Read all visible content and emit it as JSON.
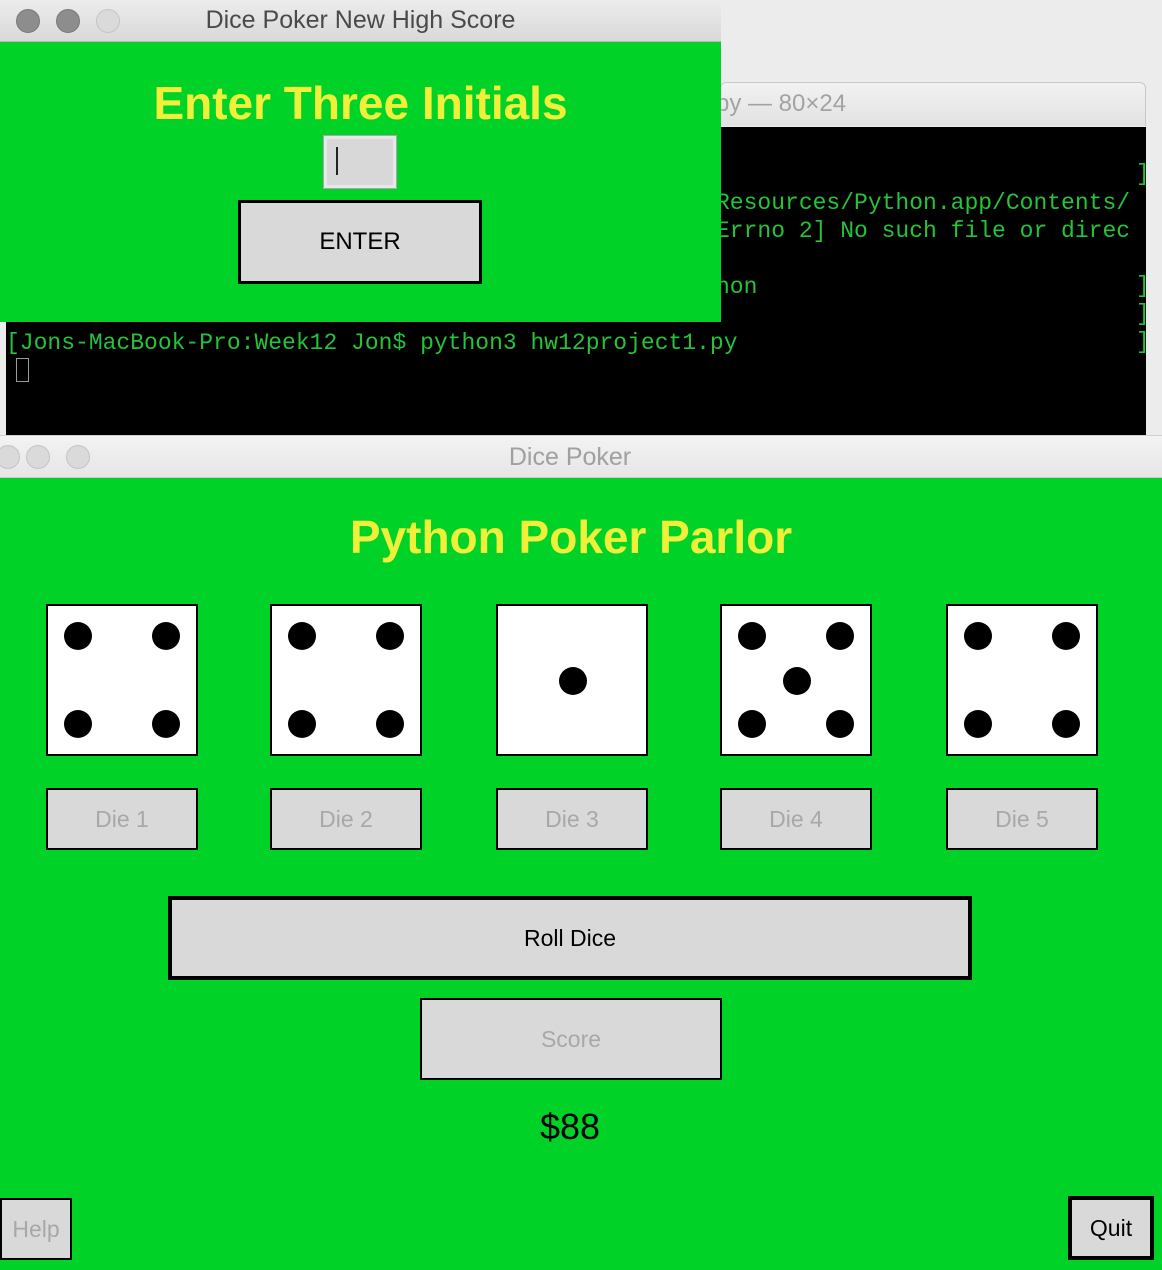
{
  "terminal": {
    "title": "py — 80×24",
    "lines": [
      "Resources/Python.app/Contents/",
      "Errno 2] No such file or direc",
      "hon",
      "[Jons-MacBook-Pro:Week12 Jon$ python3 hw12project1.py"
    ]
  },
  "high_score_dialog": {
    "window_title": "Dice Poker New High Score",
    "heading": "Enter Three Initials",
    "initials_value": "",
    "enter_label": "ENTER"
  },
  "main_window": {
    "window_title": "Dice Poker",
    "heading": "Python Poker Parlor",
    "dice_values": [
      4,
      4,
      1,
      5,
      4
    ],
    "die_buttons": [
      "Die 1",
      "Die 2",
      "Die 3",
      "Die 4",
      "Die 5"
    ],
    "roll_label": "Roll Dice",
    "score_label": "Score",
    "money": "$88",
    "help_label": "Help",
    "quit_label": "Quit"
  },
  "colors": {
    "background_green": "#00d227",
    "heading_yellow": "#f0f03a",
    "terminal_text": "#24c33a",
    "disabled_text": "#a8a8a8"
  }
}
